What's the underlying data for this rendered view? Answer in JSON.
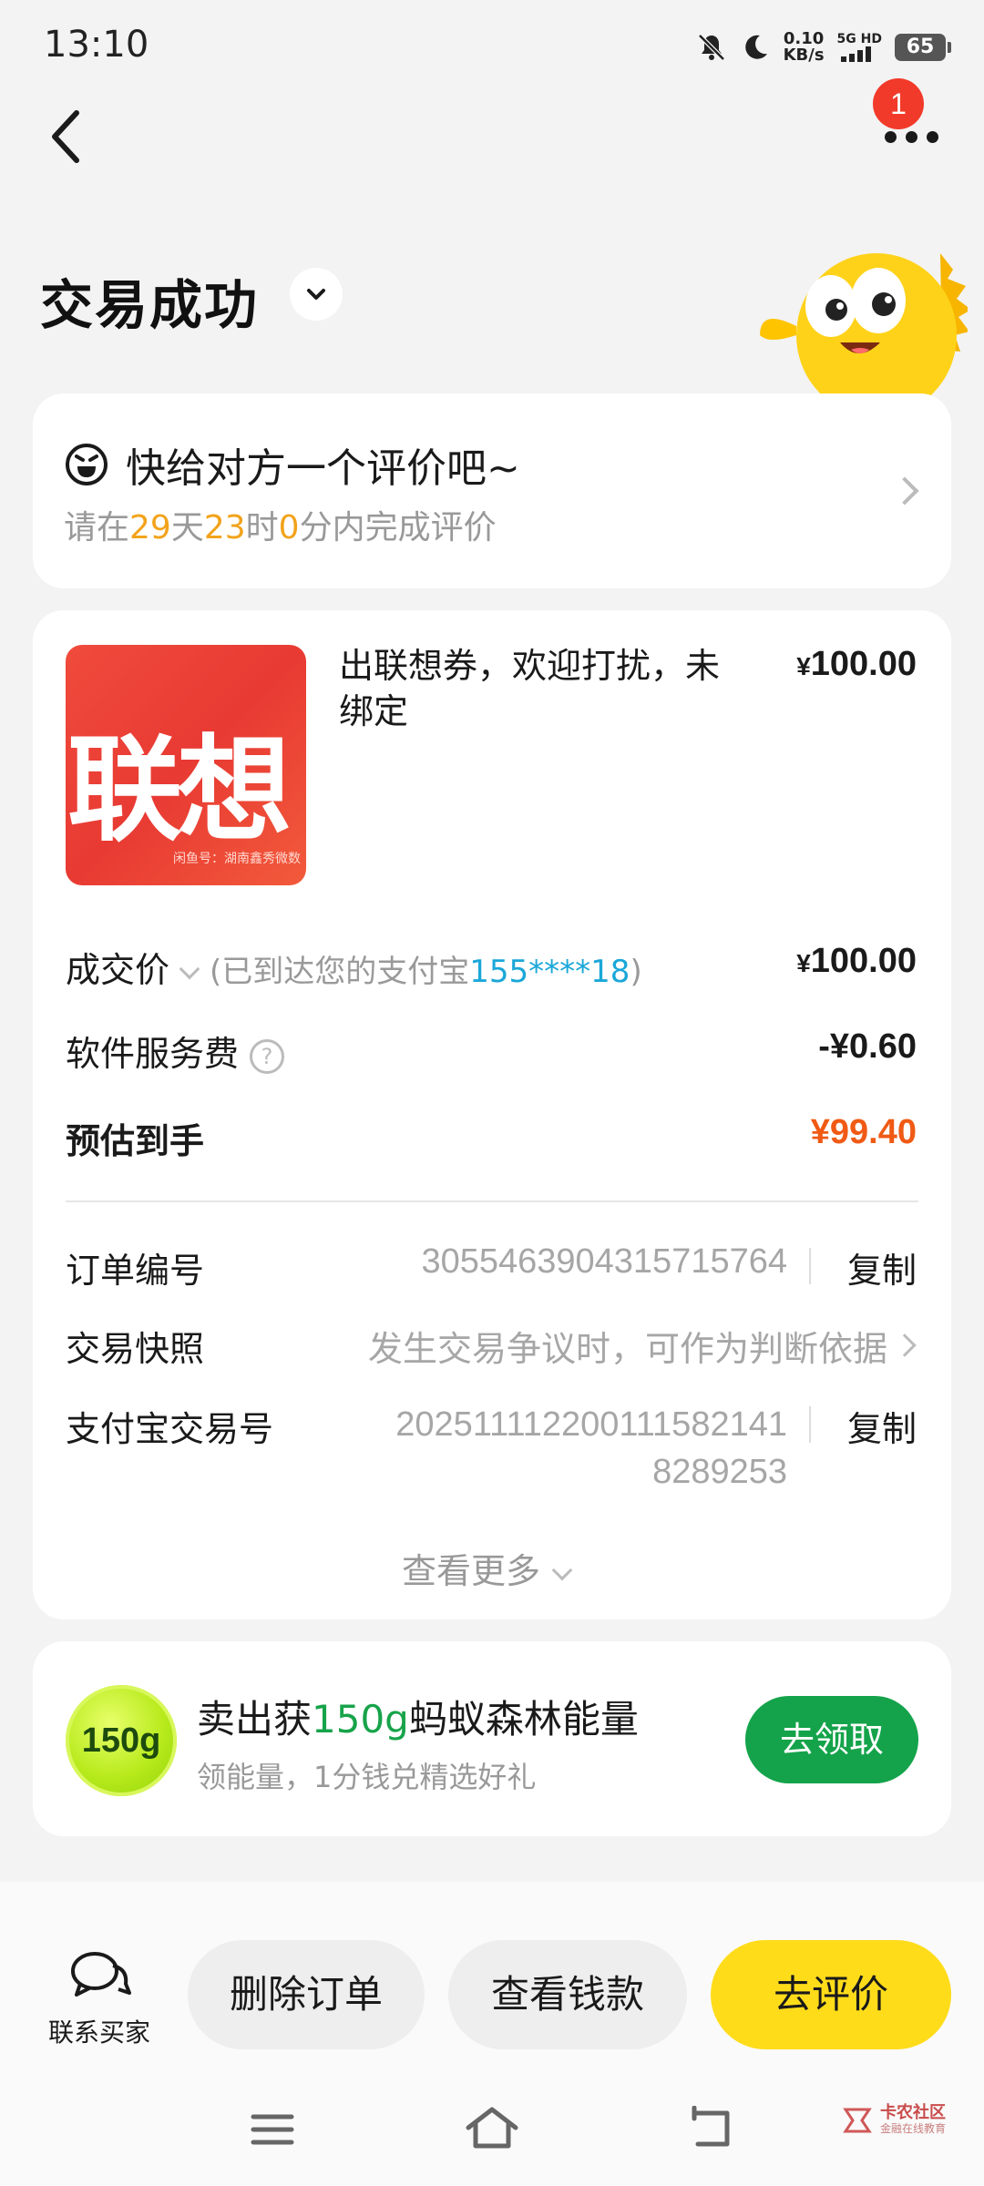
{
  "status_bar": {
    "time": "13:10",
    "net_speed_value": "0.10",
    "net_speed_unit": "KB/s",
    "signal_label": "5G HD",
    "battery": "65"
  },
  "header": {
    "notification_count": "1",
    "title": "交易成功"
  },
  "review": {
    "title": "快给对方一个评价吧~",
    "sub_prefix": "请在",
    "days": "29",
    "days_unit": "天",
    "hours": "23",
    "hours_unit": "时",
    "minutes": "0",
    "sub_suffix": "分内完成评价"
  },
  "order": {
    "thumb_text": "联想",
    "thumb_small": "闲鱼号：湖南鑫秀微数",
    "item_title": "出联想券，欢迎打扰，未绑定",
    "item_price": "100.00",
    "currency": "¥",
    "deal_label": "成交价",
    "deal_note_prefix": "(已到达您的支付宝",
    "deal_note_account": "155****18",
    "deal_note_suffix": ")",
    "deal_price": "100.00",
    "fee_label": "软件服务费",
    "fee_value": "-¥0.60",
    "estimate_label": "预估到手",
    "estimate_value": "¥99.40",
    "order_no_label": "订单编号",
    "order_no": "3055463904315715764",
    "copy_label": "复制",
    "snapshot_label": "交易快照",
    "snapshot_value": "发生交易争议时，可作为判断依据",
    "alipay_no_label": "支付宝交易号",
    "alipay_no_line1": "202511112200111582141",
    "alipay_no_line2": "8289253",
    "see_more": "查看更多"
  },
  "energy": {
    "badge": "150g",
    "title_prefix": "卖出获",
    "title_amount": "150g",
    "title_suffix": "蚂蚁森林能量",
    "sub": "领能量，1分钱兑精选好礼",
    "claim_label": "去领取"
  },
  "bottom": {
    "contact_label": "联系买家",
    "delete_label": "删除订单",
    "view_money_label": "查看钱款",
    "review_label": "去评价"
  },
  "watermark": {
    "main": "卡农社区",
    "sub": "金融在线教育"
  },
  "colors": {
    "accent_yellow": "#ffdc1a",
    "price_orange": "#f05a14",
    "countdown_orange": "#f2a31b",
    "account_blue": "#1aa7d8",
    "energy_green": "#14a34a",
    "badge_red": "#f23a2a"
  }
}
